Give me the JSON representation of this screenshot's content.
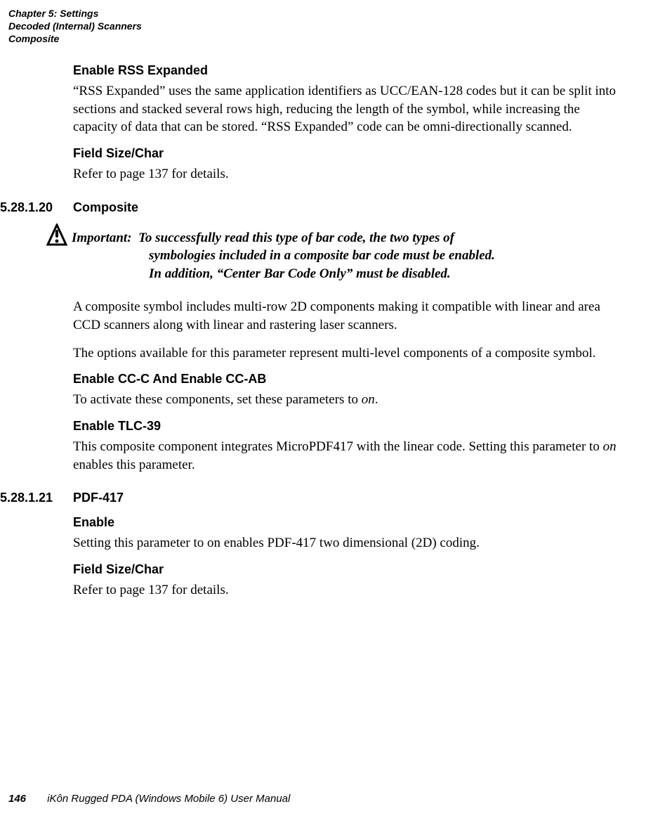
{
  "header": {
    "line1": "Chapter 5: Settings",
    "line2": "Decoded (Internal) Scanners",
    "line3": "Composite"
  },
  "section1": {
    "h_enable_rss": "Enable RSS Expanded",
    "rss_para": "“RSS Expanded” uses the same application identifiers as UCC/EAN-128 codes but it can be split into sections and stacked several rows high, reducing the length of the symbol, while increasing the capacity of data that can be stored. “RSS Expanded” code can be omni-directionally scanned.",
    "h_field_size1": "Field Size/Char",
    "ref1": "Refer to page 137 for details."
  },
  "composite": {
    "num": "5.28.1.20",
    "title": "Composite",
    "important_label": "Important:",
    "important_line1": "To successfully read this type of bar code, the two types of",
    "important_line2": "symbologies included in a composite bar code must be enabled.",
    "important_line3": "In addition, “Center Bar Code Only” must be disabled.",
    "para1": "A composite symbol includes multi-row 2D components making it compatible with linear and area CCD scanners along with linear and rastering laser scanners.",
    "para2": "The options available for this parameter represent multi-level components of a composite symbol.",
    "h_cc": "Enable CC-C And Enable CC-AB",
    "cc_para_pre": "To activate these components, set these parameters to ",
    "cc_para_em": "on",
    "cc_para_post": ".",
    "h_tlc": "Enable TLC-39",
    "tlc_pre": "This composite component integrates MicroPDF417 with the linear code. Setting this parameter to ",
    "tlc_em": "on",
    "tlc_post": " enables this parameter."
  },
  "pdf": {
    "num": "5.28.1.21",
    "title": "PDF-417",
    "h_enable": "Enable",
    "enable_para": "Setting this parameter to on enables PDF-417 two dimensional (2D) coding.",
    "h_field_size": "Field Size/Char",
    "ref": "Refer to page 137 for details."
  },
  "footer": {
    "page": "146",
    "text": "iKôn Rugged PDA (Windows Mobile 6) User Manual"
  }
}
